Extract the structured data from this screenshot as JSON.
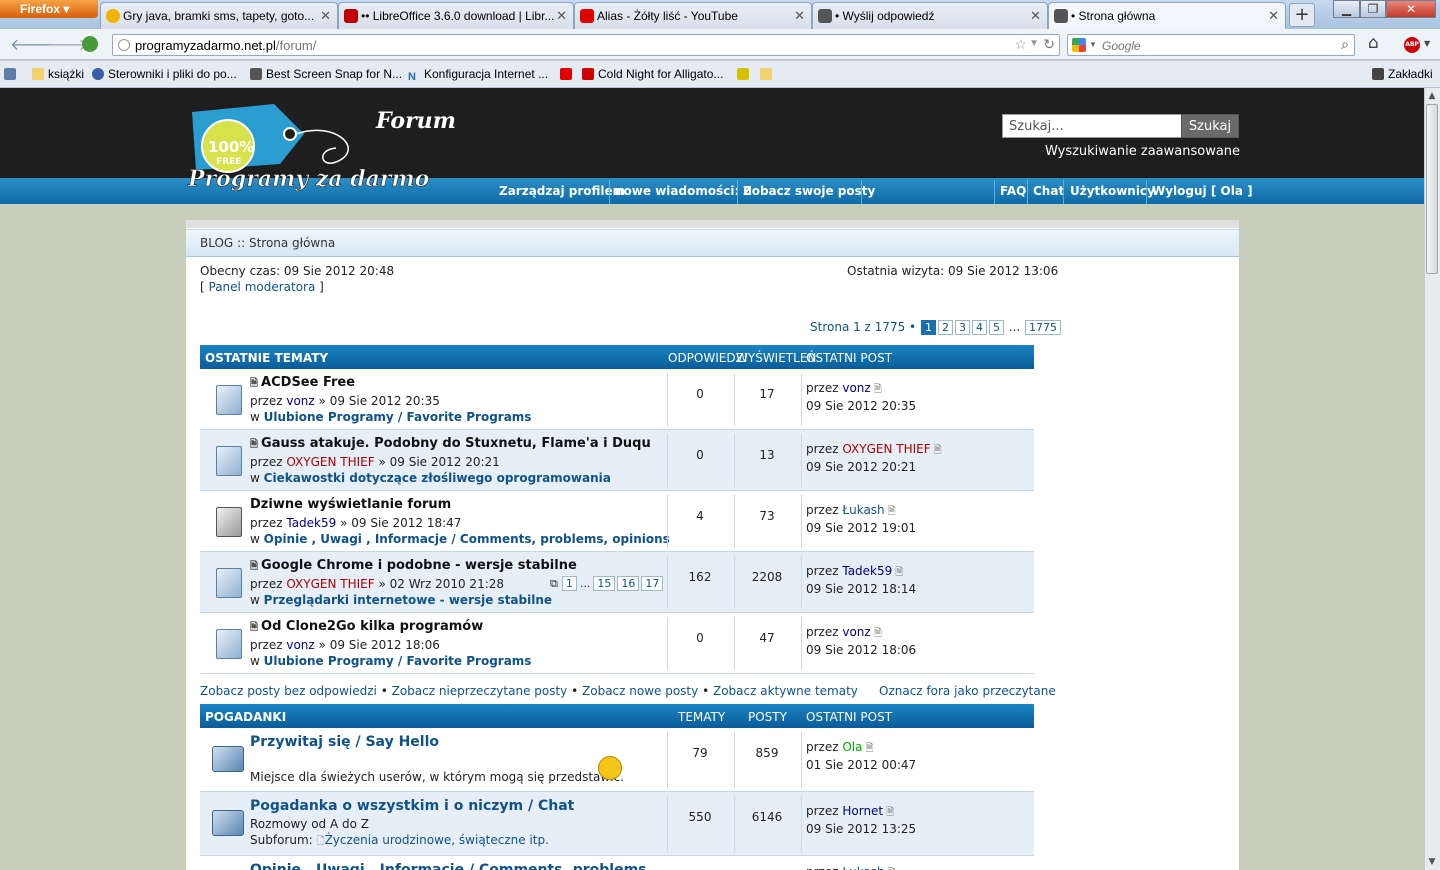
{
  "browser": {
    "app_button": "Firefox",
    "tabs": [
      {
        "title": "Gry java, bramki sms, tapety, goto...",
        "favcolor": "#f0b400"
      },
      {
        "title": "•• LibreOffice 3.6.0 download | Libr...",
        "favcolor": "#c00000"
      },
      {
        "title": "Alias - Żółty liść - YouTube",
        "favcolor": "#e00000"
      },
      {
        "title": "• Wyślij odpowiedź",
        "favcolor": "#444444"
      },
      {
        "title": "• Strona główna",
        "favcolor": "#444444"
      }
    ],
    "url_host": "programyzadarmo.net.pl",
    "url_path": "/forum/",
    "search_placeholder": "Google",
    "bookmarks": [
      "książki",
      "Sterowniki i pliki do po...",
      "Best Screen Snap for N...",
      "Konfiguracja Internet ...",
      "Cold Night for Alligato..."
    ],
    "bookmarks_menu": "Zakładki"
  },
  "forum": {
    "logo_top": "Forum",
    "logo_badge": "100%",
    "logo_badge_sub": "FREE",
    "logo_main": "Programy za darmo",
    "search_value": "Szukaj...",
    "search_button": "Szukaj",
    "advanced_search": "Wyszukiwanie zaawansowane",
    "nav_left": [
      "Zarządzaj profilem",
      "nowe wiadomości: 0",
      "Zobacz swoje posty"
    ],
    "nav_right": [
      "FAQ",
      "Chat",
      "Użytkownicy",
      "Wyloguj [ Ola ]"
    ],
    "breadcrumb": "BLOG :: Strona główna",
    "current_time": "Obecny czas: 09 Sie 2012 20:48",
    "last_visit": "Ostatnia wizyta: 09 Sie 2012 13:06",
    "moderator_panel": "Panel moderatora",
    "pagination_label": "Strona 1 z 1775 •",
    "pages": [
      "1",
      "2",
      "3",
      "4",
      "5",
      "...",
      "1775"
    ],
    "recent": {
      "header": "OSTATNIE TEMATY",
      "col_replies": "ODPOWIEDZI",
      "col_views": "WYŚWIETLEŃ",
      "col_last": "OSTATNI POST",
      "topics": [
        {
          "title": "ACDSee Free",
          "by_prefix": "przez",
          "author": "vonz",
          "author_color": "navy",
          "date": "» 09 Sie 2012 20:35",
          "in_prefix": "w",
          "forum": "Ulubione Programy / Favorite Programs",
          "replies": "0",
          "views": "17",
          "last_prefix": "przez",
          "last_author": "vonz",
          "last_color": "navy",
          "last_date": "09 Sie 2012 20:35"
        },
        {
          "title": "Gauss atakuje. Podobny do Stuxnetu, Flame'a i Duqu",
          "by_prefix": "przez",
          "author": "OXYGEN THIEF",
          "author_color": "red",
          "date": "» 09 Sie 2012 20:21",
          "in_prefix": "w",
          "forum": "Ciekawostki dotyczące złośliwego oprogramowania",
          "replies": "0",
          "views": "13",
          "last_prefix": "przez",
          "last_author": "OXYGEN THIEF",
          "last_color": "red",
          "last_date": "09 Sie 2012 20:21"
        },
        {
          "title": "Dziwne wyświetlanie forum",
          "by_prefix": "przez",
          "author": "Tadek59",
          "author_color": "navy",
          "date": "» 09 Sie 2012 18:47",
          "in_prefix": "w",
          "forum": "Opinie , Uwagi , Informacje / Comments, problems, opinions",
          "replies": "4",
          "views": "73",
          "last_prefix": "przez",
          "last_author": "Łukash",
          "last_color": "blue",
          "last_date": "09 Sie 2012 19:01"
        },
        {
          "title": "Google Chrome i podobne - wersje stabilne",
          "by_prefix": "przez",
          "author": "OXYGEN THIEF",
          "author_color": "red",
          "date": "» 02 Wrz 2010 21:28",
          "in_prefix": "w",
          "forum": "Przeglądarki internetowe - wersje stabilne",
          "replies": "162",
          "views": "2208",
          "last_prefix": "przez",
          "last_author": "Tadek59",
          "last_color": "navy",
          "last_date": "09 Sie 2012 18:14",
          "pages": [
            "1",
            "...",
            "15",
            "16",
            "17"
          ]
        },
        {
          "title": "Od Clone2Go kilka programów",
          "by_prefix": "przez",
          "author": "vonz",
          "author_color": "navy",
          "date": "» 09 Sie 2012 18:06",
          "in_prefix": "w",
          "forum": "Ulubione Programy / Favorite Programs",
          "replies": "0",
          "views": "47",
          "last_prefix": "przez",
          "last_author": "vonz",
          "last_color": "navy",
          "last_date": "09 Sie 2012 18:06"
        }
      ]
    },
    "quicklinks": [
      "Zobacz posty bez odpowiedzi",
      "Zobacz nieprzeczytane posty",
      "Zobacz nowe posty",
      "Zobacz aktywne tematy"
    ],
    "quicklinks_sep": " • ",
    "mark_read": "Oznacz fora jako przeczytane",
    "forums_section": {
      "header": "POGADANKI",
      "col_topics": "TEMATY",
      "col_posts": "POSTY",
      "col_last": "OSTATNI POST",
      "forums": [
        {
          "title": "Przywitaj się / Say Hello",
          "desc": "Miejsce dla świeżych userów, w którym mogą się przedstawić.",
          "topics": "79",
          "posts": "859",
          "last_prefix": "przez",
          "last_author": "Ola",
          "last_color": "green",
          "last_date": "01 Sie 2012 00:47"
        },
        {
          "title": "Pogadanka o wszystkim i o niczym / Chat",
          "desc": "Rozmowy od A do Z",
          "subforum_label": "Subforum:",
          "subforum": "Życzenia urodzinowe, świąteczne itp.",
          "topics": "550",
          "posts": "6146",
          "last_prefix": "przez",
          "last_author": "Hornet",
          "last_color": "navy",
          "last_date": "09 Sie 2012 13:25"
        },
        {
          "title": "Opinie , Uwagi , Informacje / Comments, problems",
          "last_prefix": "przez",
          "last_author": "Łukash",
          "last_color": "blue"
        }
      ]
    }
  }
}
